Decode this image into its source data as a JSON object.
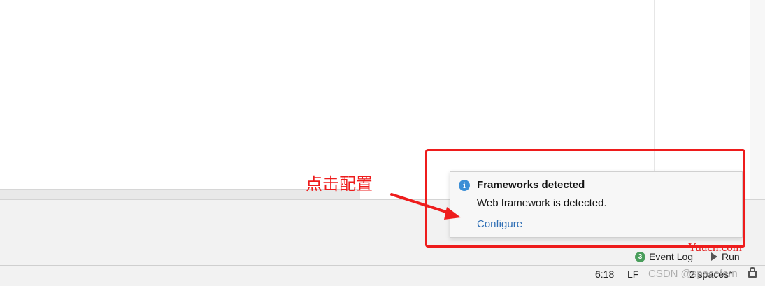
{
  "notification": {
    "title": "Frameworks detected",
    "body": "Web framework is detected.",
    "link": "Configure"
  },
  "annotation": {
    "label": "点击配置",
    "color": "#ee1c1c"
  },
  "toolbar": {
    "event_log_count": "3",
    "event_log_label": "Event Log",
    "run_label": "Run"
  },
  "status_bar": {
    "position": "6:18",
    "line_separator": "LF",
    "indent": "2 spaces*"
  },
  "watermarks": {
    "csdn": "CSDN @spacefern",
    "yuucn": "Yuucn.com"
  },
  "icons": {
    "info": "info-icon",
    "run": "run-triangle-icon",
    "lock": "lock-icon"
  },
  "colors": {
    "link": "#2f6fb5",
    "info": "#3c8fd6",
    "badge": "#4a9e5c"
  }
}
